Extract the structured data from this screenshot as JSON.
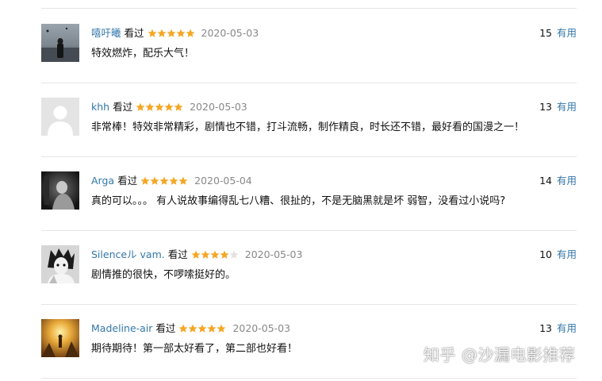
{
  "reviews": [
    {
      "username": "嘻吁曦",
      "status": "看过",
      "rating": 5,
      "date": "2020-05-03",
      "comment": "特效燃炸，配乐大气！",
      "votes": "15",
      "useful_label": "有用",
      "avatar": "avatar-photo-person-lake"
    },
    {
      "username": "khh",
      "status": "看过",
      "rating": 5,
      "date": "2020-05-03",
      "comment": "非常棒！特效非常精彩，剧情也不错，打斗流畅，制作精良，时长还不错，最好看的国漫之一！",
      "votes": "13",
      "useful_label": "有用",
      "avatar": "avatar-default-silhouette"
    },
    {
      "username": "Arga",
      "status": "看过",
      "rating": 5,
      "date": "2020-05-04",
      "comment": "真的可以。。。 有人说故事编得乱七八糟、很扯的，不是无脑黑就是坏 弱智，没看过小说吗?",
      "votes": "14",
      "useful_label": "有用",
      "avatar": "avatar-photo-dark-figure"
    },
    {
      "username": "Silenceル vam.",
      "status": "看过",
      "rating": 4,
      "date": "2020-05-03",
      "comment": "剧情推的很快，不啰嗦挺好的。",
      "votes": "10",
      "useful_label": "有用",
      "avatar": "avatar-anime-character"
    },
    {
      "username": "Madeline-air",
      "status": "看过",
      "rating": 5,
      "date": "2020-05-03",
      "comment": "期待期待！第一部太好看了，第二部也好看！",
      "votes": "13",
      "useful_label": "有用",
      "avatar": "avatar-golden-scene"
    }
  ],
  "watermark": "知乎 @沙漏电影推荐",
  "colors": {
    "link": "#3377aa",
    "star_filled": "#f5a623",
    "star_empty": "#e2e2e2",
    "date": "#888888",
    "divider": "#e6e6e6"
  }
}
